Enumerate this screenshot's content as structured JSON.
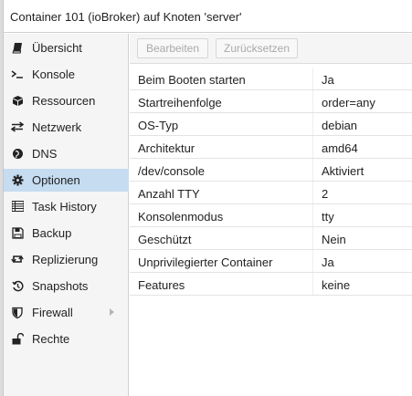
{
  "window": {
    "title": "Container 101 (ioBroker) auf Knoten 'server'"
  },
  "sidebar": {
    "items": [
      {
        "label": "Übersicht",
        "icon": "book-icon"
      },
      {
        "label": "Konsole",
        "icon": "terminal-icon"
      },
      {
        "label": "Ressourcen",
        "icon": "cube-icon"
      },
      {
        "label": "Netzwerk",
        "icon": "exchange-icon"
      },
      {
        "label": "DNS",
        "icon": "globe-icon"
      },
      {
        "label": "Optionen",
        "icon": "gear-icon",
        "active": true
      },
      {
        "label": "Task History",
        "icon": "list-icon"
      },
      {
        "label": "Backup",
        "icon": "floppy-icon"
      },
      {
        "label": "Replizierung",
        "icon": "retweet-icon"
      },
      {
        "label": "Snapshots",
        "icon": "history-icon"
      },
      {
        "label": "Firewall",
        "icon": "shield-icon",
        "has_submenu": true
      },
      {
        "label": "Rechte",
        "icon": "unlock-icon"
      }
    ]
  },
  "toolbar": {
    "edit_label": "Bearbeiten",
    "reset_label": "Zurücksetzen"
  },
  "options": {
    "rows": [
      {
        "key": "Beim Booten starten",
        "value": "Ja"
      },
      {
        "key": "Startreihenfolge",
        "value": "order=any"
      },
      {
        "key": "OS-Typ",
        "value": "debian"
      },
      {
        "key": "Architektur",
        "value": "amd64"
      },
      {
        "key": "/dev/console",
        "value": "Aktiviert"
      },
      {
        "key": "Anzahl TTY",
        "value": "2"
      },
      {
        "key": "Konsolenmodus",
        "value": "tty"
      },
      {
        "key": "Geschützt",
        "value": "Nein"
      },
      {
        "key": "Unprivilegierter Container",
        "value": "Ja"
      },
      {
        "key": "Features",
        "value": "keine"
      }
    ]
  },
  "colors": {
    "active_item": "#c5dcf1",
    "sidebar_bg": "#f5f5f5"
  }
}
